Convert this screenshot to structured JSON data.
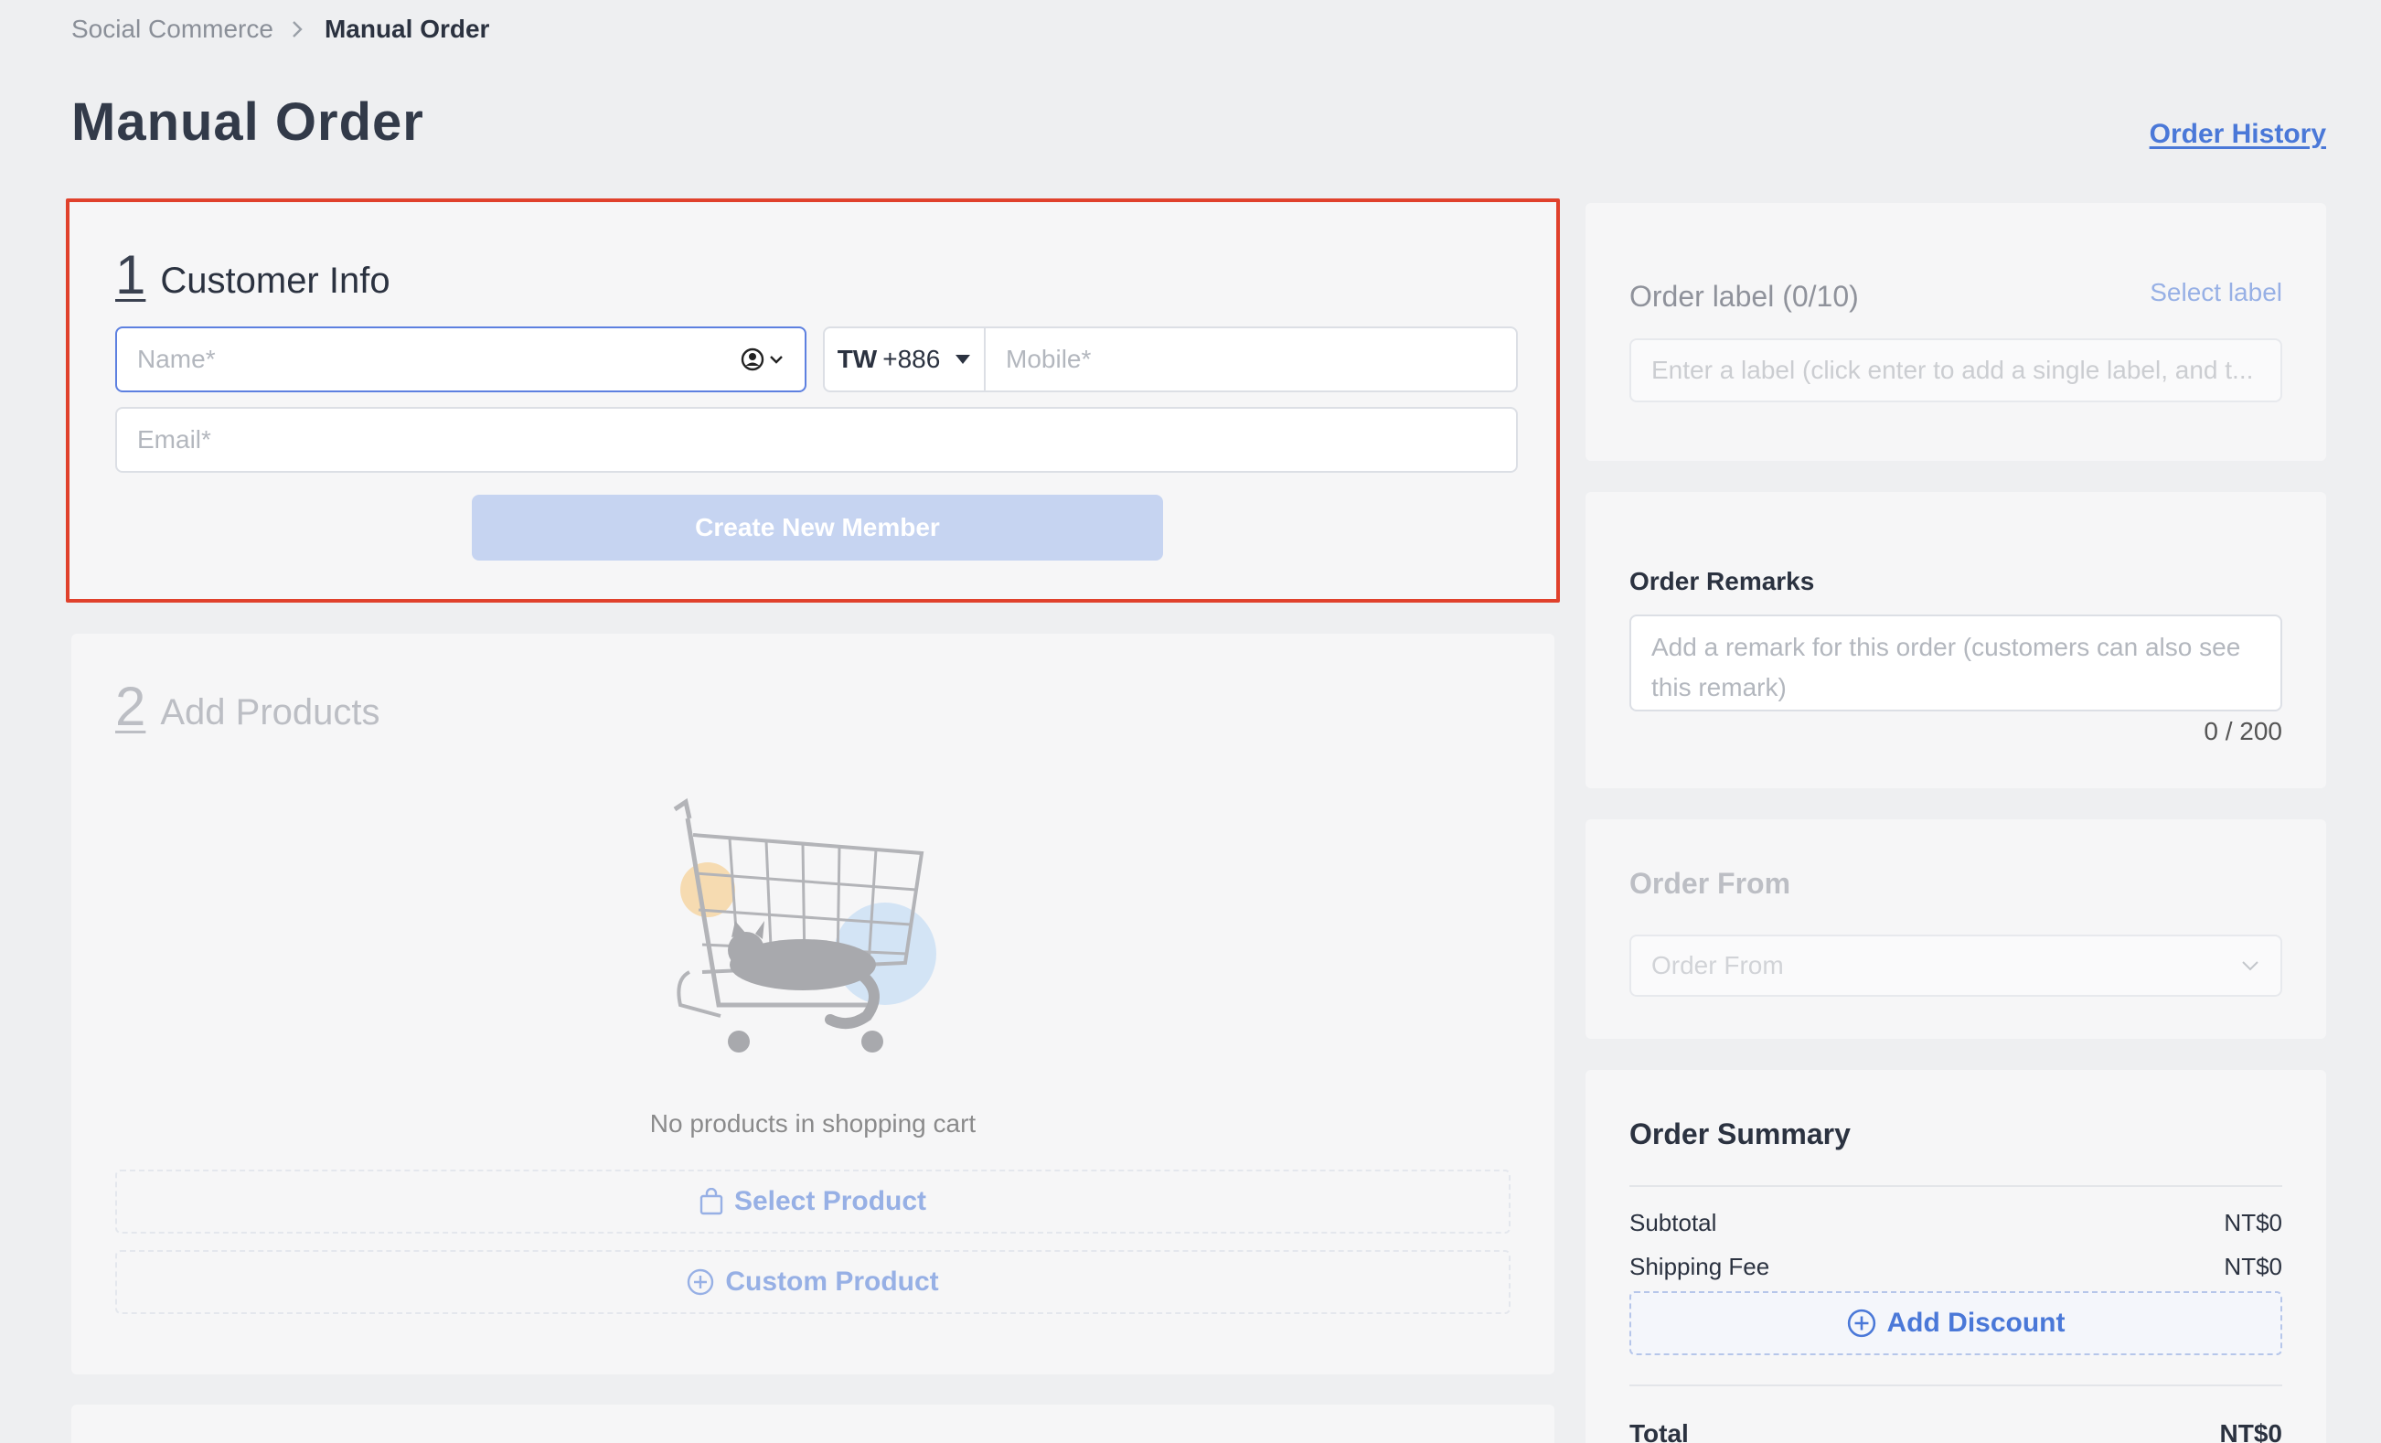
{
  "breadcrumb": {
    "parent": "Social Commerce",
    "current": "Manual Order"
  },
  "header": {
    "title": "Manual Order",
    "order_history": "Order History"
  },
  "customer_info": {
    "step": "1",
    "title": "Customer Info",
    "name_placeholder": "Name*",
    "country_code": "TW",
    "dial_code": "+886",
    "mobile_placeholder": "Mobile*",
    "email_placeholder": "Email*",
    "create_member": "Create New Member"
  },
  "add_products": {
    "step": "2",
    "title": "Add Products",
    "empty_text": "No products in shopping cart",
    "select_product": "Select Product",
    "custom_product": "Custom Product"
  },
  "order_label": {
    "title": "Order label (0/10)",
    "select_label": "Select label",
    "placeholder": "Enter a label (click enter to add a single label, and t..."
  },
  "order_remarks": {
    "title": "Order Remarks",
    "placeholder": "Add a remark for this order (customers can also see this remark)",
    "counter": "0 / 200"
  },
  "order_from": {
    "title": "Order From",
    "placeholder": "Order From"
  },
  "order_summary": {
    "title": "Order Summary",
    "subtotal_label": "Subtotal",
    "subtotal_value": "NT$0",
    "shipping_label": "Shipping Fee",
    "shipping_value": "NT$0",
    "add_discount": "Add Discount",
    "total_label": "Total",
    "total_value": "NT$0"
  },
  "colors": {
    "accent": "#4a78d8",
    "highlight_border": "#e0412c",
    "button_disabled": "#c6d4f1"
  }
}
